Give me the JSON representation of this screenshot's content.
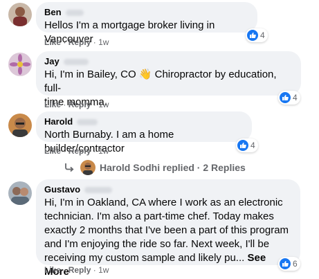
{
  "comments": [
    {
      "name": "Ben",
      "text": "Hellos I'm a mortgage broker living in Vancouver",
      "reactions": "4",
      "like": "Like",
      "reply": "Reply",
      "time": "1w"
    },
    {
      "name": "Jay",
      "text_line1": "Hi, I'm in Bailey, CO 👋 Chiropractor by education, full-",
      "text_line2": "time momma.",
      "reactions": "4",
      "like": "Like",
      "reply": "Reply",
      "time": "1w"
    },
    {
      "name": "Harold",
      "text": "North Burnaby. I am a home builder/contractor",
      "reactions": "4",
      "like": "Like",
      "reply": "Reply",
      "time": "1w"
    },
    {
      "name": "Gustavo",
      "lines": [
        "Hi, I'm in Oakland, CA where I work as an electronic",
        "technician. I'm also a part-time chef. Today makes",
        "exactly 2 months that I've been a part of this program",
        "and I'm enjoying the ride so far. Next week, I'll be"
      ],
      "last_line": "receiving my custom sample and likely pu...",
      "see_more": "See More",
      "reactions": "6",
      "like": "Like",
      "reply": "Reply",
      "time": "1w"
    }
  ],
  "reply_thread": {
    "text": "Harold Sodhi replied · 2 Replies"
  },
  "separator": "·",
  "colors": {
    "bubble": "#f0f2f5",
    "like_blue": "#1877f2",
    "meta_gray": "#65676b",
    "text": "#050505"
  },
  "icons": [
    "like-icon",
    "reply-arrow-icon"
  ]
}
